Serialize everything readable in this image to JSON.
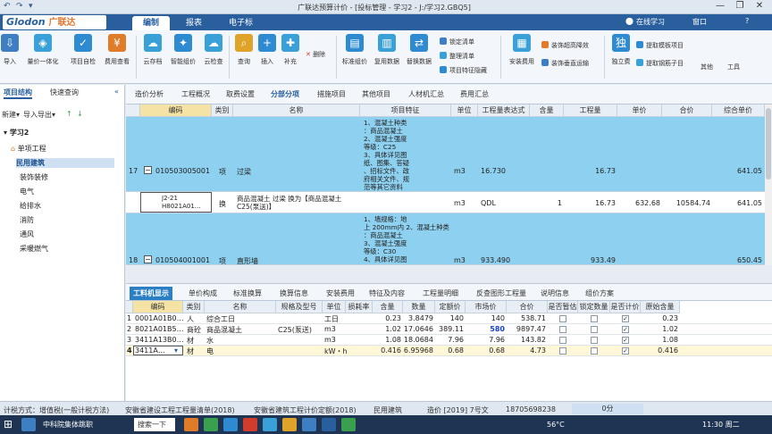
{
  "window": {
    "title": "广联达预算计价 - [投标管理 - 学习2 - J:/学习2.GBQ5]",
    "quick_access": [
      "↶",
      "↷",
      "▾"
    ]
  },
  "menubar": {
    "logo_en": "Glodon",
    "logo_cn": "广联达",
    "tabs": [
      "编制",
      "报表",
      "电子标"
    ],
    "active_tab": "编制",
    "right": {
      "online": "在线学习",
      "window": "窗口",
      "help": "?"
    }
  },
  "ribbon": {
    "buttons": [
      {
        "label": "导入",
        "color": "#3d7fc2"
      },
      {
        "label": "量价一体化",
        "color": "#3aa0d8"
      },
      {
        "label": "项目自检",
        "color": "#2f8bd1"
      },
      {
        "label": "费用查看",
        "color": "#e07b2a"
      },
      {
        "label": "云存档",
        "color": "#3aa0d8"
      },
      {
        "label": "智能组价",
        "color": "#2f8bd1"
      },
      {
        "label": "云检查",
        "color": "#3aa0d8"
      },
      {
        "label": "查询",
        "color": "#e0a32a"
      },
      {
        "label": "插入",
        "color": "#2f8bd1"
      },
      {
        "label": "补充",
        "color": "#3aa0d8"
      },
      {
        "label": "标准组价",
        "color": "#2f8bd1"
      },
      {
        "label": "复用数据",
        "color": "#3aa0d8"
      },
      {
        "label": "替换数据",
        "color": "#2f8bd1"
      },
      {
        "label": "安装费用",
        "color": "#3aa0d8"
      },
      {
        "label": "独立费",
        "color": "#2f8bd1"
      }
    ],
    "small_delete": "删除",
    "lock": [
      "锁定清单",
      "整理清单",
      "项目特征隐藏"
    ],
    "decor": [
      "装饰超高降效",
      "装饰垂直运输"
    ],
    "extract": [
      "提取模板项目",
      "提取钢筋子目"
    ],
    "more": "其他",
    "tools": "工具"
  },
  "left_panel": {
    "tabs": [
      "项目结构",
      "快速查询"
    ],
    "toolbar": [
      "新建▾",
      "导入导出▾",
      "↑",
      "↓"
    ],
    "tree": [
      {
        "label": "学习2",
        "level": 0
      },
      {
        "label": "单项工程",
        "level": 1
      },
      {
        "label": "民用建筑",
        "level": 2
      },
      {
        "label": "装饰装修",
        "level": 2
      },
      {
        "label": "电气",
        "level": 2
      },
      {
        "label": "给排水",
        "level": 2
      },
      {
        "label": "消防",
        "level": 2
      },
      {
        "label": "通风",
        "level": 2
      },
      {
        "label": "采暖燃气",
        "level": 2
      }
    ]
  },
  "sub_tabs": {
    "items": [
      "造价分析",
      "工程概况",
      "取费设置",
      "分部分项",
      "措施项目",
      "其他项目",
      "人材机汇总",
      "费用汇总"
    ],
    "active": "分部分项"
  },
  "upper_grid": {
    "headers": [
      "编码",
      "类别",
      "名称",
      "项目特征",
      "单位",
      "工程量表达式",
      "含量",
      "工程量",
      "单价",
      "合价",
      "综合单价"
    ],
    "rows": [
      {
        "num": "17",
        "code": "010503005001",
        "type": "项",
        "name": "过梁",
        "feature": "1、混凝土种类\n：商品混凝土\n2、混凝土强度\n等级：C25\n3、具体详见图\n纸、图集、答疑\n、招标文件、政\n府相关文件、规\n范等其它资料",
        "unit": "m3",
        "expr": "16.730",
        "content": "",
        "qty": "16.73",
        "price": "",
        "total": "",
        "unit_price": "641.05"
      },
      {
        "num": "",
        "code": "J2-21\nH8021A01…",
        "type": "换",
        "name": "商品混凝土 过梁  换为【商品混凝土\nC25(泵送)】",
        "feature": "",
        "unit": "m3",
        "expr": "QDL",
        "content": "1",
        "qty": "16.73",
        "price": "632.68",
        "total": "10584.74",
        "unit_price": "641.05"
      },
      {
        "num": "18",
        "code": "010504001001",
        "type": "项",
        "name": "直形墙",
        "feature": "1、墙规格：地\n上 200mm内 2、混凝土种类\n：商品混凝土\n3、混凝土强度\n等级：C30\n4、具体详见图",
        "unit": "m3",
        "expr": "933.490",
        "content": "",
        "qty": "933.49",
        "price": "",
        "total": "",
        "unit_price": "650.45"
      }
    ]
  },
  "bottom_tabs": {
    "items": [
      "工料机显示",
      "单价构成",
      "标准换算",
      "换算信息",
      "安装费用",
      "特征及内容",
      "工程量明细",
      "反查图形工程量",
      "说明信息",
      "组价方案"
    ],
    "active": "工料机显示"
  },
  "lower_grid": {
    "headers": [
      "编码",
      "类别",
      "名称",
      "规格及型号",
      "单位",
      "损耗率",
      "含量",
      "数量",
      "定额价",
      "市场价",
      "合价",
      "是否暂估",
      "锁定数量",
      "是否计价",
      "原始含量"
    ],
    "rows": [
      {
        "num": "1",
        "code": "0001A01B0…",
        "type": "人",
        "name": "综合工日",
        "spec": "",
        "unit": "工日",
        "loss": "",
        "content": "0.23",
        "qty": "3.8479",
        "quota": "140",
        "market": "140",
        "total": "538.71",
        "est": false,
        "lock": false,
        "priced": true,
        "orig": "0.23",
        "market_hl": false
      },
      {
        "num": "2",
        "code": "8021A01B5…",
        "type": "商砼",
        "name": "商品混凝土",
        "spec": "C25(泵送)",
        "unit": "m3",
        "loss": "",
        "content": "1.02",
        "qty": "17.0646",
        "quota": "389.11",
        "market": "580",
        "total": "9897.47",
        "est": false,
        "lock": false,
        "priced": true,
        "orig": "1.02",
        "market_hl": true
      },
      {
        "num": "3",
        "code": "3411A13B0…",
        "type": "材",
        "name": "水",
        "spec": "",
        "unit": "m3",
        "loss": "",
        "content": "1.08",
        "qty": "18.0684",
        "quota": "7.96",
        "market": "7.96",
        "total": "143.82",
        "est": false,
        "lock": false,
        "priced": true,
        "orig": "1.08",
        "market_hl": false
      },
      {
        "num": "4",
        "code": "3411A…",
        "type": "材",
        "name": "电",
        "spec": "",
        "unit": "kW・h",
        "loss": "",
        "content": "0.416",
        "qty": "6.95968",
        "quota": "0.68",
        "market": "0.68",
        "total": "4.73",
        "est": false,
        "lock": false,
        "priced": true,
        "orig": "0.416",
        "market_hl": false
      }
    ]
  },
  "status_bar": {
    "items": [
      "计税方式：增值税(一般计税方法)",
      "安徽省建设工程工程量清单(2018)",
      "安徽省建筑工程计价定额(2018)",
      "民用建筑",
      "造价 [2019] 7号文",
      "18705698238",
      "0分"
    ]
  },
  "taskbar": {
    "search": "搜索一下",
    "app1": "中科院集体跳职",
    "weather": "56°C",
    "time": "11:30 周二"
  }
}
